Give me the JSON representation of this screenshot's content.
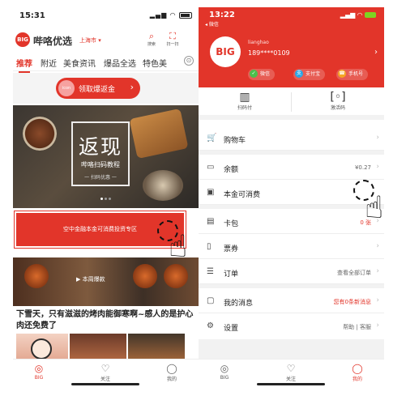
{
  "left": {
    "status": {
      "time": "15:31",
      "signal": "▂▄▆",
      "wifi": "◠"
    },
    "header": {
      "logo_text": "BIG",
      "brand": "哔咯优选",
      "city": "上海市 ▾",
      "icons": [
        {
          "name": "search-icon",
          "glyph": "⌕",
          "label": "搜索"
        },
        {
          "name": "scan-icon",
          "glyph": "⛶",
          "label": "扫一扫"
        }
      ]
    },
    "tabs": [
      "推荐",
      "附近",
      "美食资讯",
      "爆品全选",
      "特色美"
    ],
    "tab_more": "⊙",
    "promo": {
      "icon_text": "icon",
      "label": "领取爆返金",
      "arrow": "›"
    },
    "banner": {
      "title": "返现",
      "subtitle": "哔咯扫码教程",
      "caption": "一 扫码优惠 一"
    },
    "red_box": "空中金融本金可消费投资专区",
    "food_banner_label": "▶ 本周爆款",
    "article_title": "下雪天，只有滋滋的烤肉能御寒啊~感人的是护心肉还免费了",
    "tabbar": [
      {
        "name": "big",
        "glyph": "◎",
        "label": "BIG",
        "active": true
      },
      {
        "name": "follow",
        "glyph": "♡",
        "label": "关注",
        "active": false
      },
      {
        "name": "mine",
        "glyph": "◯",
        "label": "我的",
        "active": false
      }
    ]
  },
  "right": {
    "status": {
      "time": "13:22",
      "back": "◂ 微信",
      "signal": "▂▄▆ ◠"
    },
    "profile": {
      "avatar_text": "BIG",
      "username": "lianghao",
      "phone": "189****0109",
      "arrow": "›",
      "payments": [
        {
          "name": "wechat",
          "label": "微信",
          "color": "#4cbf4c",
          "glyph": "✓"
        },
        {
          "name": "alipay",
          "label": "支付宝",
          "color": "#2aa6e5",
          "glyph": "支"
        },
        {
          "name": "mobile",
          "label": "手机号",
          "color": "#f5a623",
          "glyph": "☎"
        }
      ]
    },
    "actions": [
      {
        "name": "pay-code",
        "glyph": "▥",
        "label": "扫码付"
      },
      {
        "name": "activation-code",
        "glyph": "[◦]",
        "label": "激活码"
      }
    ],
    "menu": [
      {
        "name": "cart",
        "glyph": "🛒",
        "label": "购物车",
        "value": ""
      },
      {
        "name": "balance",
        "glyph": "▭",
        "label": "余额",
        "value": "¥0.27"
      },
      {
        "name": "principal",
        "glyph": "▣",
        "label": "本金可消费",
        "value": ""
      },
      {
        "name": "card-package",
        "glyph": "▤",
        "label": "卡包",
        "value": "0 张"
      },
      {
        "name": "tickets",
        "glyph": "▯",
        "label": "票券",
        "value": ""
      },
      {
        "name": "orders",
        "glyph": "☰",
        "label": "订单",
        "value": "查看全部订单"
      },
      {
        "name": "messages",
        "glyph": "▢",
        "label": "我的消息",
        "value": "您有0条新消息"
      },
      {
        "name": "settings",
        "glyph": "⚙",
        "label": "设置",
        "value": "帮助 | 客服"
      }
    ],
    "tabbar": [
      {
        "name": "big",
        "glyph": "◎",
        "label": "BIG",
        "active": false
      },
      {
        "name": "follow",
        "glyph": "♡",
        "label": "关注",
        "active": false
      },
      {
        "name": "mine",
        "glyph": "◯",
        "label": "我的",
        "active": true
      }
    ]
  },
  "hand_glyph": "☝",
  "accent": "#e2352a"
}
